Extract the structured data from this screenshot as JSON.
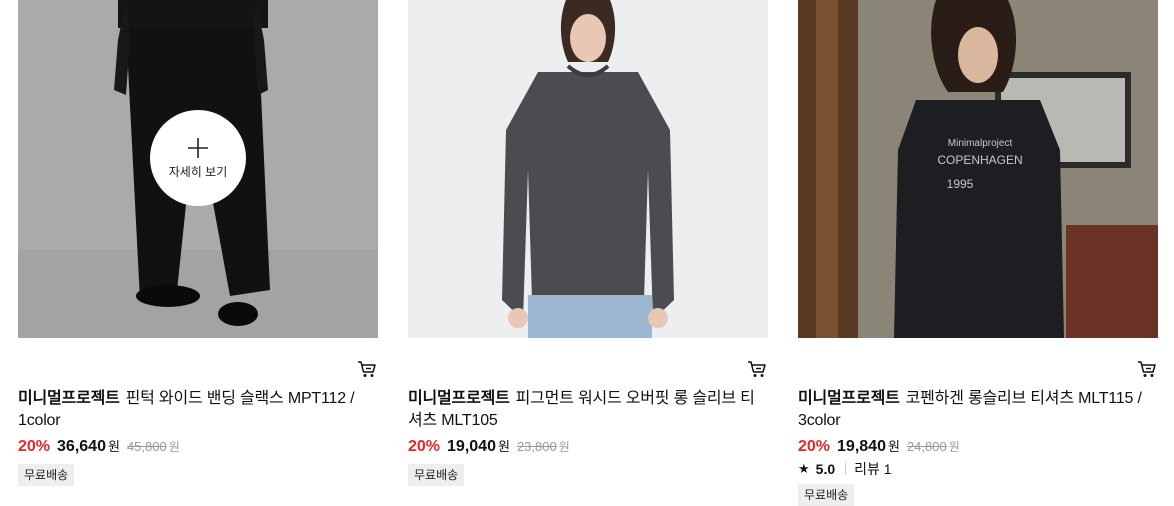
{
  "products": [
    {
      "brand": "미니멀프로젝트",
      "name": "핀턱 와이드 밴딩 슬랙스 MPT112 / 1color",
      "discount": "20%",
      "price": "36,640",
      "currency": "원",
      "original_price": "45,800",
      "badge": "무료배송",
      "detail_label": "자세히 보기",
      "hovered": true
    },
    {
      "brand": "미니멀프로젝트",
      "name": "피그먼트 워시드 오버핏 롱 슬리브 티셔츠 MLT105",
      "discount": "20%",
      "price": "19,040",
      "currency": "원",
      "original_price": "23,800",
      "badge": "무료배송"
    },
    {
      "brand": "미니멀프로젝트",
      "name": "코펜하겐 롱슬리브 티셔츠 MLT115 / 3color",
      "discount": "20%",
      "price": "19,840",
      "currency": "원",
      "original_price": "24,800",
      "rating": "5.0",
      "review_label": "리뷰",
      "review_count": "1",
      "badge": "무료배송",
      "print": {
        "line1": "Minimalproject",
        "line2": "COPENHAGEN",
        "line3": "1995"
      }
    }
  ],
  "colors": {
    "discount": "#e8262a",
    "badge_bg": "#eeeeee"
  },
  "icons": [
    "cart-icon",
    "plus-icon",
    "star-icon"
  ]
}
